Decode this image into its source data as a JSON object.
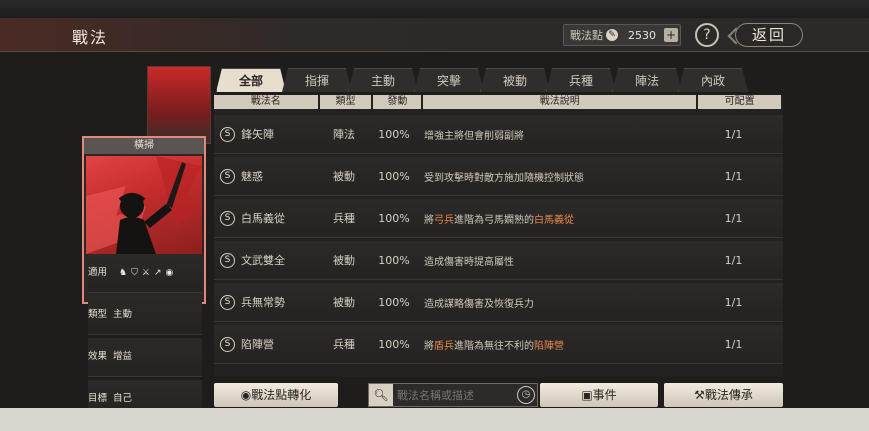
{
  "header": {
    "title": "戰法",
    "points_label": "戰法點",
    "points_value": "2530",
    "plus": "+",
    "help": "?",
    "back": "返回"
  },
  "card": {
    "name": "橫掃",
    "stats": [
      {
        "label": "適用",
        "value": ""
      },
      {
        "label": "類型",
        "value": "主動"
      },
      {
        "label": "效果",
        "value": "增益"
      },
      {
        "label": "目標",
        "value": "自己"
      }
    ],
    "unit_icons": [
      "cavalry-icon",
      "shield-icon",
      "crossed-swords-icon",
      "spear-icon",
      "wheel-icon"
    ]
  },
  "tabs": [
    {
      "label": "全部",
      "active": true
    },
    {
      "label": "指揮",
      "active": false
    },
    {
      "label": "主動",
      "active": false
    },
    {
      "label": "突擊",
      "active": false
    },
    {
      "label": "被動",
      "active": false
    },
    {
      "label": "兵種",
      "active": false
    },
    {
      "label": "陣法",
      "active": false
    },
    {
      "label": "內政",
      "active": false
    }
  ],
  "table": {
    "headers": [
      "戰法名",
      "類型",
      "發動",
      "戰法說明",
      "可配置"
    ],
    "rows": [
      {
        "badge": "S",
        "name": "鋒矢陣",
        "type": "陣法",
        "rate": "100%",
        "desc_parts": [
          {
            "t": "增強主將但會削弱副將",
            "hl": false
          }
        ],
        "slots": "1/1"
      },
      {
        "badge": "S",
        "name": "魅惑",
        "type": "被動",
        "rate": "100%",
        "desc_parts": [
          {
            "t": "受到攻擊時對敵方施加隨機控制狀態",
            "hl": false
          }
        ],
        "slots": "1/1"
      },
      {
        "badge": "S",
        "name": "白馬義從",
        "type": "兵種",
        "rate": "100%",
        "desc_parts": [
          {
            "t": "將",
            "hl": false
          },
          {
            "t": "弓兵",
            "hl": true
          },
          {
            "t": "進階為弓馬嫻熟的",
            "hl": false
          },
          {
            "t": "白馬義從",
            "hl": true
          }
        ],
        "slots": "1/1"
      },
      {
        "badge": "S",
        "name": "文武雙全",
        "type": "被動",
        "rate": "100%",
        "desc_parts": [
          {
            "t": "造成傷害時提高屬性",
            "hl": false
          }
        ],
        "slots": "1/1"
      },
      {
        "badge": "S",
        "name": "兵無常勢",
        "type": "被動",
        "rate": "100%",
        "desc_parts": [
          {
            "t": "造成謀略傷害及恢復兵力",
            "hl": false
          }
        ],
        "slots": "1/1"
      },
      {
        "badge": "S",
        "name": "陷陣營",
        "type": "兵種",
        "rate": "100%",
        "desc_parts": [
          {
            "t": "將",
            "hl": false
          },
          {
            "t": "盾兵",
            "hl": true
          },
          {
            "t": "進階為無往不利的",
            "hl": false
          },
          {
            "t": "陷陣營",
            "hl": true
          }
        ],
        "slots": "1/1"
      }
    ]
  },
  "bottom": {
    "convert_label": "戰法點轉化",
    "search_placeholder": "戰法名稱或描述",
    "event_label": "事件",
    "inherit_label": "戰法傳承"
  },
  "colors": {
    "accent_red": "#d63a3a",
    "highlight_orange": "#e5874e",
    "card_border": "#e08a7e"
  }
}
